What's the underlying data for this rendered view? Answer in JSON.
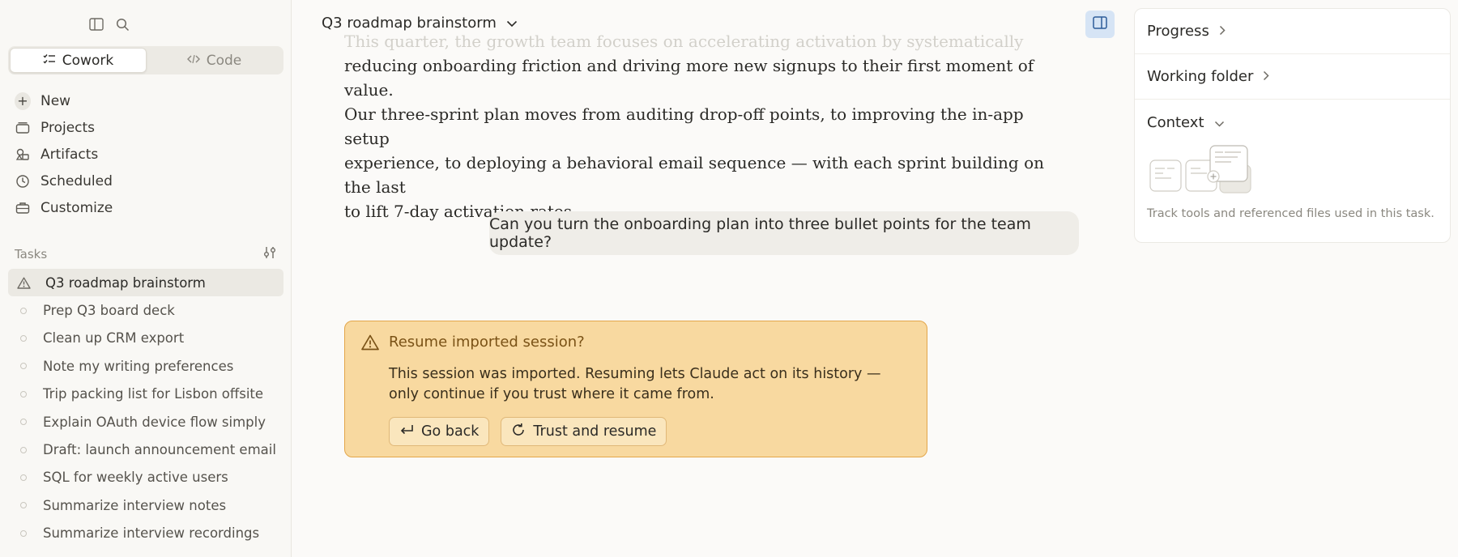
{
  "sidebar": {
    "top_icons": [
      "sidebar-toggle-icon",
      "search-icon"
    ],
    "modes": [
      {
        "label": "Cowork",
        "icon": "checklist-icon",
        "active": true
      },
      {
        "label": "Code",
        "icon": "code-icon",
        "active": false
      }
    ],
    "nav": [
      {
        "label": "New",
        "icon": "plus-icon"
      },
      {
        "label": "Projects",
        "icon": "folder-icon"
      },
      {
        "label": "Artifacts",
        "icon": "shapes-icon"
      },
      {
        "label": "Scheduled",
        "icon": "clock-icon"
      },
      {
        "label": "Customize",
        "icon": "briefcase-icon"
      }
    ],
    "tasks_label": "Tasks",
    "tasks": [
      {
        "label": "Q3 roadmap brainstorm",
        "active": true
      },
      {
        "label": "Prep Q3 board deck"
      },
      {
        "label": "Clean up CRM export"
      },
      {
        "label": "Note my writing preferences"
      },
      {
        "label": "Trip packing list for Lisbon offsite"
      },
      {
        "label": "Explain OAuth device flow simply"
      },
      {
        "label": "Draft: launch announcement email"
      },
      {
        "label": "SQL for weekly active users"
      },
      {
        "label": "Summarize interview notes"
      },
      {
        "label": "Summarize interview recordings"
      }
    ]
  },
  "header": {
    "title": "Q3 roadmap brainstorm"
  },
  "conversation": {
    "assistant_partial_line": "This quarter, the growth team focuses on accelerating activation by systematically",
    "assistant_lines": [
      "reducing onboarding friction and driving more new signups to their first moment of value.",
      "Our three-sprint plan moves from auditing drop-off points, to improving the in-app setup",
      "experience, to deploying a behavioral email sequence — with each sprint building on the last",
      "to lift 7-day activation rates."
    ],
    "user_message": "Can you turn the onboarding plan into three bullet points for the team update?"
  },
  "alert": {
    "title": "Resume imported session?",
    "body": "This session was imported. Resuming lets Claude act on its history — only continue if you trust where it came from.",
    "go_back_label": "Go back",
    "trust_label": "Trust and resume"
  },
  "right_panel": {
    "progress_label": "Progress",
    "working_folder_label": "Working folder",
    "context_label": "Context",
    "context_hint": "Track tools and referenced files used in this task."
  },
  "colors": {
    "alert_bg": "#f8d9a0",
    "alert_border": "#e3a64a",
    "accent_blue": "#d6e4f5"
  }
}
